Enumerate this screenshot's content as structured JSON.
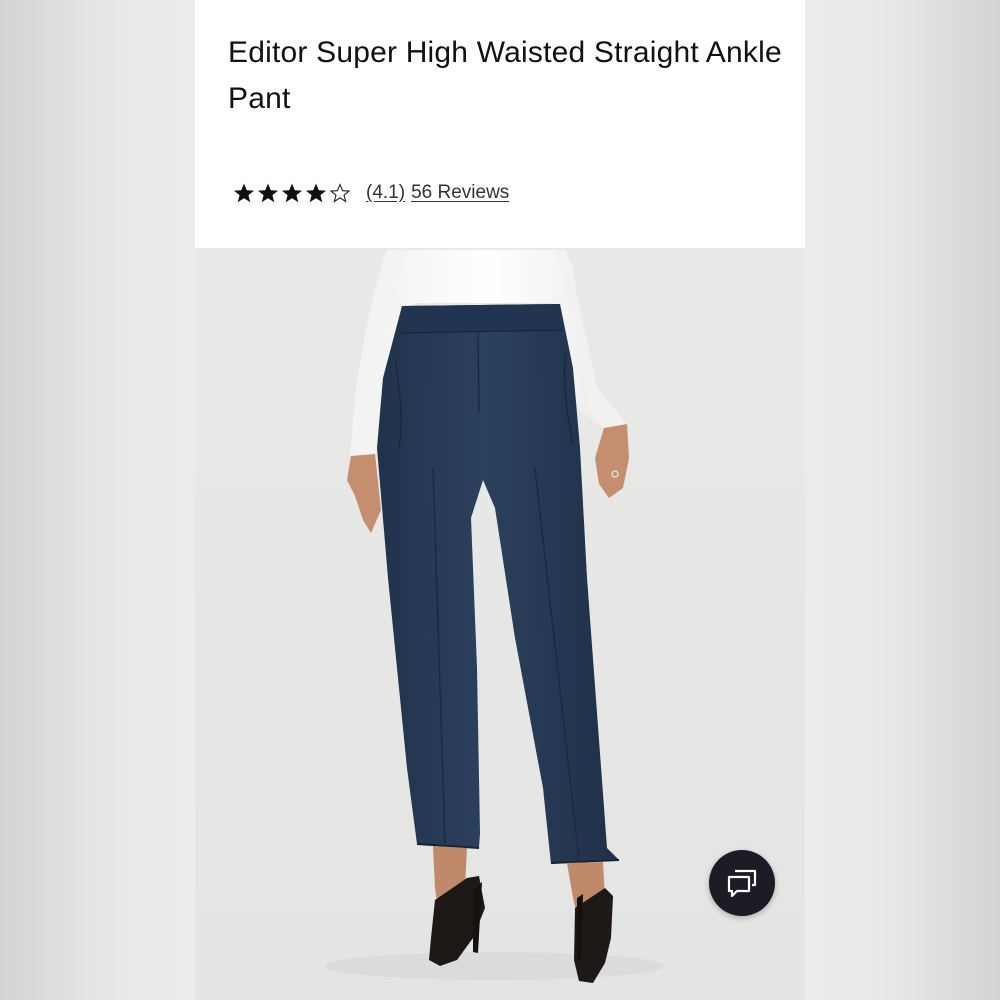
{
  "product": {
    "title": "Editor Super High Waisted Straight Ankle Pant",
    "rating": {
      "value_label": "(4.1)",
      "reviews_label": "56 Reviews",
      "stars_filled": 4,
      "stars_total": 5
    }
  },
  "image": {
    "subject": "model-wearing-navy-ankle-pants"
  },
  "chat": {
    "icon": "chat-bubbles-icon"
  },
  "colors": {
    "header_bg": "#ffffff",
    "pant_navy": "#263a55",
    "chat_button_bg": "#1c1c24"
  }
}
